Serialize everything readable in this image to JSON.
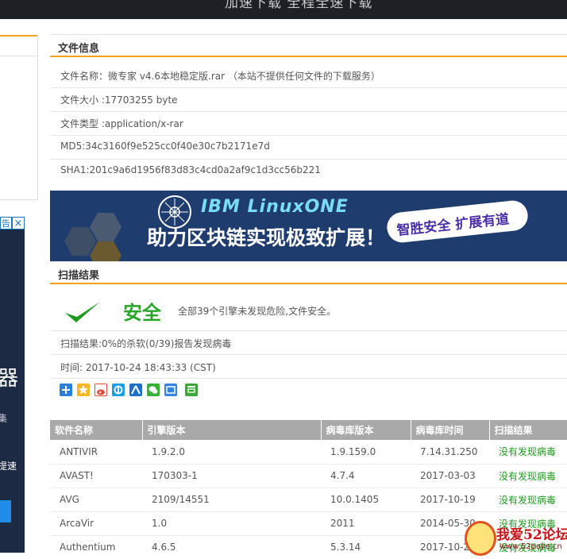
{
  "top_banner": {
    "text": "加速下载 全程全速下载"
  },
  "left_ad": {
    "tag": "告",
    "close": "×",
    "big_text": "器",
    "line1": "集",
    "line2": "提速"
  },
  "file_info": {
    "title": "文件信息",
    "rows": [
      "文件名称：微专家 v4.6本地稳定版.rar （本站不提供任何文件的下载服务）",
      "文件大小 :17703255 byte",
      "文件类型 :application/x-rar",
      "MD5:34c3160f9e525cc0f40e30c7b2171e7d",
      "SHA1:201c9a6d1956f83d83c4cd0a2af9c1d3cc56b221"
    ]
  },
  "banner": {
    "brand": "IBM LinuxONE",
    "headline": "助力区块链实现极致扩展！",
    "pill": "智胜安全 扩展有道"
  },
  "scan": {
    "title": "扫描结果",
    "status": "安全",
    "status_desc": "全部39个引擎未发现危险,文件安全。",
    "summary": "扫描结果:0%的杀软(0/39)报告发现病毒",
    "time": "时间: 2017-10-24 18:43:33 (CST)",
    "share_icons": [
      "plus-share-icon",
      "qzone-icon",
      "weibo-icon",
      "pengyou-icon",
      "renren-icon",
      "wechat-icon",
      "tieba-icon",
      "douban-icon"
    ],
    "colors": {
      "safe": "#2aa52a",
      "accent": "#f5a31a"
    }
  },
  "table": {
    "headers": [
      "软件名称",
      "引擎版本",
      "病毒库版本",
      "病毒库时间",
      "扫描结果"
    ],
    "rows": [
      [
        "ANTIVIR",
        "1.9.2.0",
        "1.9.159.0",
        "7.14.31.250",
        "没有发现病毒"
      ],
      [
        "AVAST!",
        "170303-1",
        "4.7.4",
        "2017-03-03",
        "没有发现病毒"
      ],
      [
        "AVG",
        "2109/14551",
        "10.0.1405",
        "2017-10-19",
        "没有发现病毒"
      ],
      [
        "ArcaVir",
        "1.0",
        "2011",
        "2014-05-30",
        "没有发现病毒"
      ],
      [
        "Authentium",
        "4.6.5",
        "5.3.14",
        "2017-10-2",
        "没有发现病毒"
      ]
    ]
  },
  "watermark": {
    "text": "我爱52论坛",
    "url": "www.52pojie.cn"
  }
}
